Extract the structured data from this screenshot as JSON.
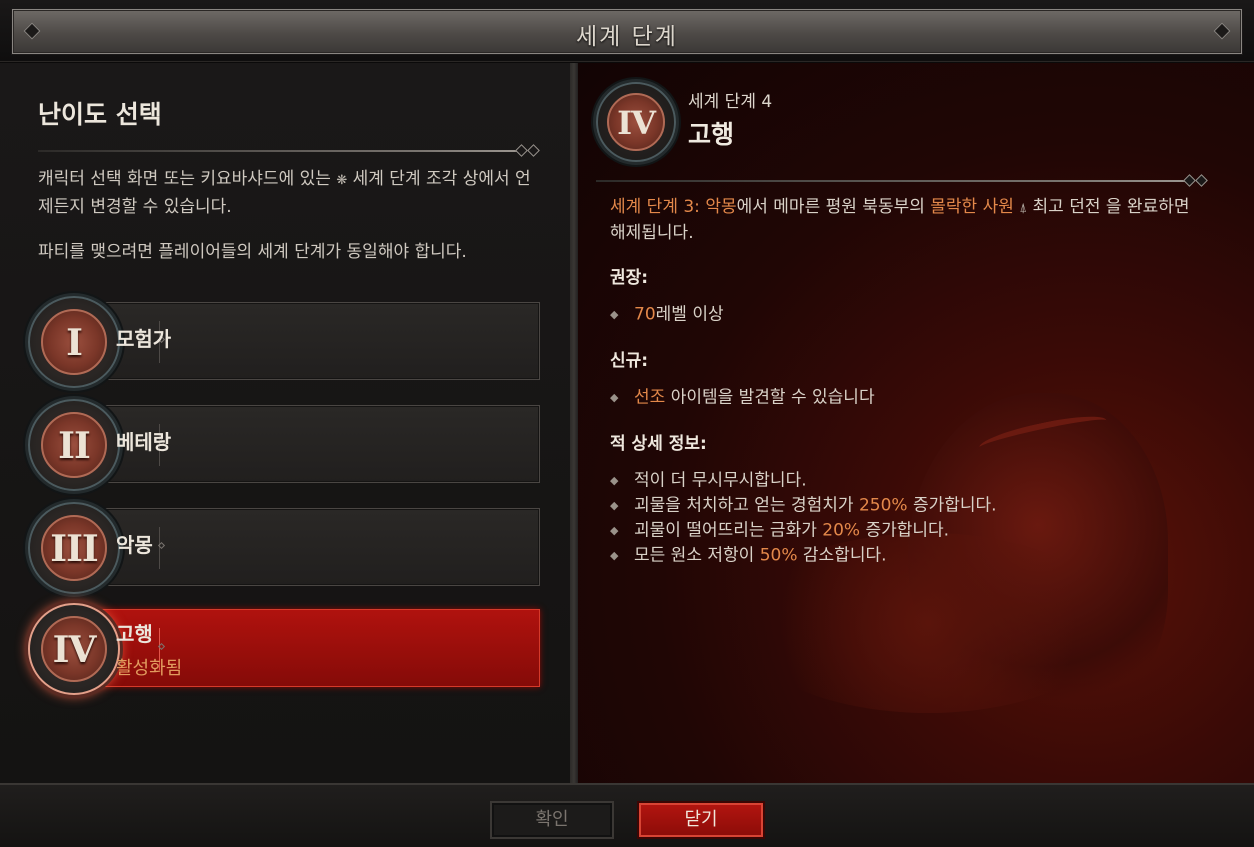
{
  "window": {
    "title": "세계 단계"
  },
  "left": {
    "heading": "난이도 선택",
    "desc1_a": "캐릭터 선택 화면 또는 키요바샤드에 있는",
    "desc1_b": "세계 단계 조각",
    "desc1_c": "상에서 언제든지 변경할 수 있습니다.",
    "desc2": "파티를 맺으려면 플레이어들의 세계 단계가 동일해야 합니다.",
    "tiers": [
      {
        "numeral": "I",
        "name": "모험가"
      },
      {
        "numeral": "II",
        "name": "베테랑"
      },
      {
        "numeral": "III",
        "name": "악몽"
      },
      {
        "numeral": "IV",
        "name": "고행",
        "status": "활성화됨"
      }
    ]
  },
  "right": {
    "numeral": "IV",
    "level_label": "세계 단계 4",
    "level_name": "고행",
    "unlock": {
      "part1": "세계 단계 3: 악몽",
      "part2": "에서 메마른 평원 북동부의",
      "part3": "몰락한 사원",
      "part4": "최고 던전",
      "part5": "을 완료하면 해제됩니다."
    },
    "recommended_head": "권장:",
    "recommended_value": "70",
    "recommended_rest": "레벨 이상",
    "new_head": "신규:",
    "new_value": "선조",
    "new_rest": "아이템을 발견할 수 있습니다",
    "enemy_head": "적 상세 정보:",
    "enemy": [
      {
        "pre": "적이 더 무시무시합니다."
      },
      {
        "pre": "괴물을 처치하고 얻는 경험치가",
        "val": "250%",
        "post": "증가합니다."
      },
      {
        "pre": "괴물이 떨어뜨리는 금화가",
        "val": "20%",
        "post": "증가합니다."
      },
      {
        "pre": "모든 원소 저항이",
        "val": "50%",
        "post": "감소합니다."
      }
    ]
  },
  "footer": {
    "confirm": "확인",
    "close": "닫기"
  },
  "colors": {
    "accent_orange": "#e3884a",
    "active_red": "#b0120e"
  }
}
